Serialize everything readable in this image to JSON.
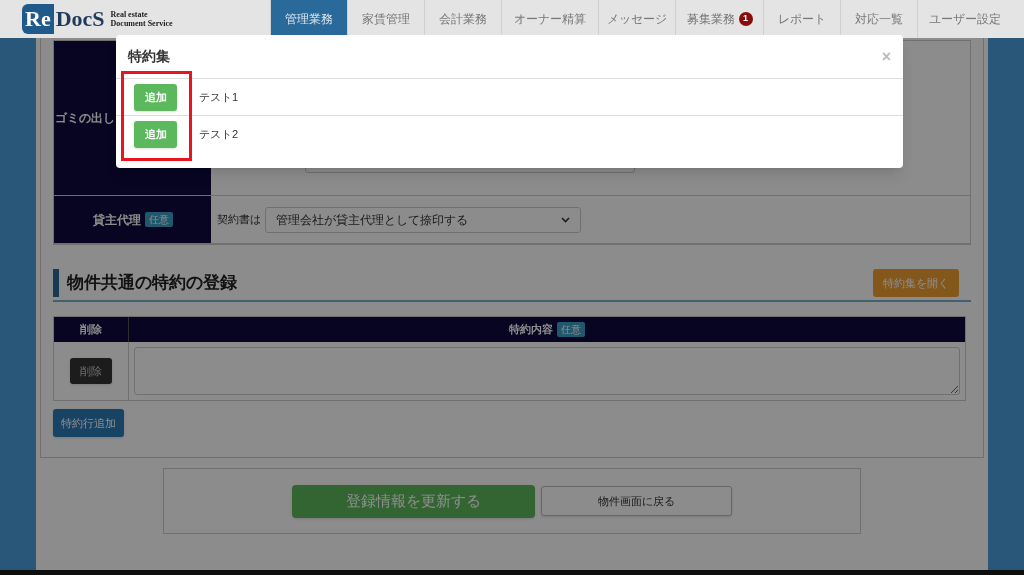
{
  "header": {
    "logo": {
      "mark_re": "Re",
      "mark_docs": "DocS",
      "tagline_1": "Real estate",
      "tagline_2": "Document Service"
    },
    "nav": [
      {
        "label": "管理業務",
        "selected": true
      },
      {
        "label": "家賃管理",
        "selected": false
      },
      {
        "label": "会計業務",
        "selected": false
      },
      {
        "label": "オーナー精算",
        "selected": false
      },
      {
        "label": "メッセージ",
        "selected": false
      },
      {
        "label": "募集業務",
        "selected": false,
        "badge": "1"
      },
      {
        "label": "レポート",
        "selected": false
      },
      {
        "label": "対応一覧",
        "selected": false
      },
      {
        "label": "ユーザー設定",
        "selected": false
      }
    ]
  },
  "form": {
    "rows": [
      {
        "kind": "input",
        "label": "ゴミの出し"
      },
      {
        "kind": "select",
        "label": "貸主代理",
        "badge": "任意",
        "prefix": "契約書は",
        "value": "管理会社が貸主代理として捺印する"
      }
    ]
  },
  "section": {
    "title": "物件共通の特約の登録",
    "open_button": "特約集を開く",
    "table": {
      "columns": [
        {
          "label": "削除"
        },
        {
          "label": "特約内容",
          "badge": "任意"
        }
      ],
      "rows": [
        {
          "delete_button": "削除"
        }
      ]
    },
    "add_button": "特約行追加"
  },
  "footer_buttons": [
    {
      "kind": "primary",
      "label": "登録情報を更新する"
    },
    {
      "kind": "secondary",
      "label": "物件画面に戻る"
    }
  ],
  "modal": {
    "title": "特約集",
    "close": "×",
    "items": [
      {
        "button": "追加",
        "text": "テスト1"
      },
      {
        "button": "追加",
        "text": "テスト2"
      }
    ]
  }
}
